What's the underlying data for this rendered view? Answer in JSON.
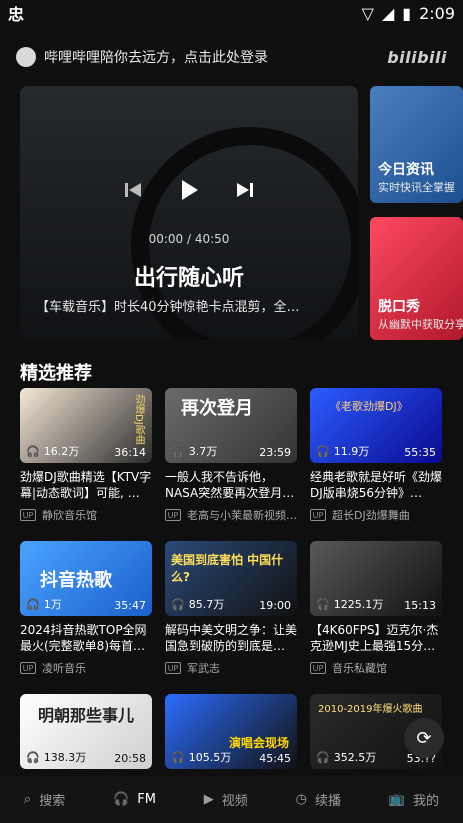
{
  "status": {
    "time": "2:09"
  },
  "header": {
    "login_text": "哔哩哔哩陪你去远方，点击此处登录",
    "logo_text": "bilibili"
  },
  "hero": {
    "time": "00:00 / 40:50",
    "title": "出行随心听",
    "desc": "【车载音乐】时长40分钟惊艳卡点混剪，全…"
  },
  "side_cards": [
    {
      "title": "今日资讯",
      "subtitle": "实时快讯全掌握"
    },
    {
      "title": "脱口秀",
      "subtitle": "从幽默中获取分享"
    }
  ],
  "section": {
    "title": "精选推荐"
  },
  "cards": [
    {
      "title": "劲爆DJ歌曲精选【KTV字幕|动态歌词】可能, …",
      "uploader": "静欣音乐馆",
      "plays": "16.2万",
      "duration": "36:14",
      "thumb_text": "劲爆DJ歌曲"
    },
    {
      "title": "一般人我不告诉他，NASA突然要再次登月…",
      "uploader": "老高与小茉最新视频…",
      "plays": "3.7万",
      "duration": "23:59",
      "thumb_text": "再次登月"
    },
    {
      "title": "经典老歌就是好听《劲爆DJ版串烧56分钟》…",
      "uploader": "超长DJ劲爆舞曲",
      "plays": "11.9万",
      "duration": "55:35",
      "thumb_text": "《老歌劲爆DJ》"
    },
    {
      "title": "2024抖音热歌TOP全网最火(完整歌单8)每首…",
      "uploader": "凌听音乐",
      "plays": "1万",
      "duration": "35:47",
      "thumb_text": "抖音热歌"
    },
    {
      "title": "解码中美文明之争：让美国急到破防的到底是…",
      "uploader": "军武志",
      "plays": "85.7万",
      "duration": "19:00",
      "thumb_text": "美国到底害怕 中国什么?"
    },
    {
      "title": "【4K60FPS】迈克尔·杰克逊MJ史上最强15分…",
      "uploader": "音乐私藏馆",
      "plays": "1225.1万",
      "duration": "15:13",
      "thumb_text": ""
    },
    {
      "title": "",
      "uploader": "",
      "plays": "138.3万",
      "duration": "20:58",
      "thumb_text": "明朝那些事儿"
    },
    {
      "title": "",
      "uploader": "",
      "plays": "105.5万",
      "duration": "45:45",
      "thumb_text": "演唱会现场"
    },
    {
      "title": "",
      "uploader": "",
      "plays": "352.5万",
      "duration": "53:??",
      "thumb_text": "2010-2019年爆火歌曲"
    }
  ],
  "nav": [
    {
      "label": "搜索",
      "icon": "search-icon"
    },
    {
      "label": "FM",
      "icon": "headphones-icon"
    },
    {
      "label": "视频",
      "icon": "video-icon"
    },
    {
      "label": "续播",
      "icon": "clock-icon"
    },
    {
      "label": "我的",
      "icon": "tv-icon"
    }
  ]
}
